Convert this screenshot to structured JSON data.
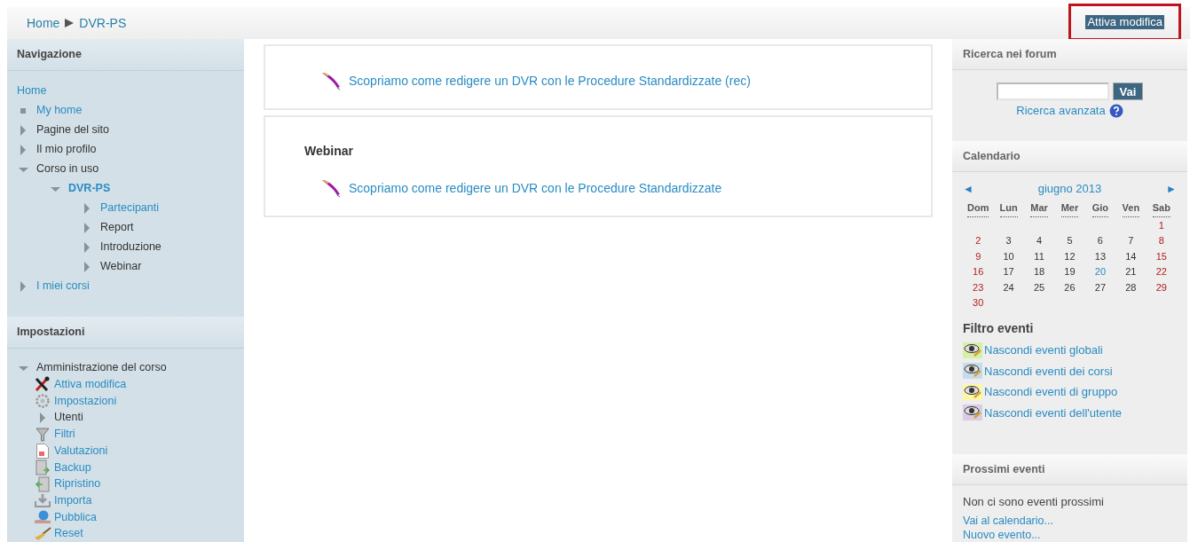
{
  "breadcrumb": [
    "Home",
    "DVR-PS"
  ],
  "edit_button": "Attiva modifica",
  "navigation": {
    "title": "Navigazione",
    "root": "Home",
    "items": [
      {
        "label": "My home",
        "kind": "leaf",
        "link": true
      },
      {
        "label": "Pagine del sito",
        "kind": "node",
        "link": false,
        "expanded": false
      },
      {
        "label": "Il mio profilo",
        "kind": "node",
        "link": false,
        "expanded": false
      },
      {
        "label": "Corso in uso",
        "kind": "node",
        "link": false,
        "expanded": true,
        "children": [
          {
            "label": "DVR-PS",
            "kind": "node",
            "link": true,
            "bold": true,
            "expanded": true,
            "children": [
              {
                "label": "Partecipanti",
                "kind": "node",
                "link": true,
                "expanded": false
              },
              {
                "label": "Report",
                "kind": "node",
                "link": false,
                "expanded": false
              },
              {
                "label": "Introduzione",
                "kind": "node",
                "link": false,
                "expanded": false
              },
              {
                "label": "Webinar",
                "kind": "node",
                "link": false,
                "expanded": false
              }
            ]
          }
        ]
      },
      {
        "label": "I miei corsi",
        "kind": "node",
        "link": true,
        "expanded": false
      }
    ]
  },
  "settings": {
    "title": "Impostazioni",
    "group": "Amministrazione del corso",
    "group_expanded": true,
    "items": [
      {
        "label": "Attiva modifica",
        "kind": "edit",
        "link": true
      },
      {
        "label": "Impostazioni",
        "kind": "gear",
        "link": true
      },
      {
        "label": "Utenti",
        "kind": "node",
        "link": false
      },
      {
        "label": "Filtri",
        "kind": "filter",
        "link": true
      },
      {
        "label": "Valutazioni",
        "kind": "grades",
        "link": true
      },
      {
        "label": "Backup",
        "kind": "backup",
        "link": true
      },
      {
        "label": "Ripristino",
        "kind": "restore",
        "link": true
      },
      {
        "label": "Importa",
        "kind": "import",
        "link": true
      },
      {
        "label": "Pubblica",
        "kind": "publish",
        "link": true
      },
      {
        "label": "Reset",
        "kind": "broom",
        "link": true
      }
    ]
  },
  "sections": [
    {
      "activity": "Scopriamo come redigere un DVR con le Procedure Standardizzate (rec)"
    },
    {
      "title": "Webinar",
      "activity": "Scopriamo come redigere un DVR con le Procedure Standardizzate"
    }
  ],
  "forum_search": {
    "title": "Ricerca nei forum",
    "button": "Vai",
    "advanced": "Ricerca avanzata"
  },
  "calendar": {
    "title": "Calendario",
    "prev": "◄",
    "month": "giugno 2013",
    "next": "►",
    "weekdays": [
      "Dom",
      "Lun",
      "Mar",
      "Mer",
      "Gio",
      "Ven",
      "Sab"
    ],
    "weeks": [
      {
        "kind": "first",
        "days": [
          {
            "day": "1",
            "kind": "weekend"
          }
        ]
      },
      {
        "kind": "full",
        "days": [
          {
            "day": "2",
            "kind": "weekend"
          },
          {
            "day": "3",
            "kind": "weekday"
          },
          {
            "day": "4",
            "kind": "weekday"
          },
          {
            "day": "5",
            "kind": "weekday"
          },
          {
            "day": "6",
            "kind": "weekday"
          },
          {
            "day": "7",
            "kind": "weekday"
          },
          {
            "day": "8",
            "kind": "weekend"
          }
        ]
      },
      {
        "kind": "full",
        "days": [
          {
            "day": "9",
            "kind": "weekend"
          },
          {
            "day": "10",
            "kind": "weekday"
          },
          {
            "day": "11",
            "kind": "weekday"
          },
          {
            "day": "12",
            "kind": "weekday"
          },
          {
            "day": "13",
            "kind": "weekday"
          },
          {
            "day": "14",
            "kind": "weekday"
          },
          {
            "day": "15",
            "kind": "weekend"
          }
        ]
      },
      {
        "kind": "full",
        "days": [
          {
            "day": "16",
            "kind": "weekend"
          },
          {
            "day": "17",
            "kind": "weekday"
          },
          {
            "day": "18",
            "kind": "weekday"
          },
          {
            "day": "19",
            "kind": "weekday"
          },
          {
            "day": "20",
            "kind": "today"
          },
          {
            "day": "21",
            "kind": "weekday"
          },
          {
            "day": "22",
            "kind": "weekend"
          }
        ]
      },
      {
        "kind": "full",
        "days": [
          {
            "day": "23",
            "kind": "weekend"
          },
          {
            "day": "24",
            "kind": "weekday"
          },
          {
            "day": "25",
            "kind": "weekday"
          },
          {
            "day": "26",
            "kind": "weekday"
          },
          {
            "day": "27",
            "kind": "weekday"
          },
          {
            "day": "28",
            "kind": "weekday"
          },
          {
            "day": "29",
            "kind": "weekend"
          }
        ]
      },
      {
        "kind": "last",
        "days": [
          {
            "day": "30",
            "kind": "weekend"
          }
        ]
      }
    ],
    "filter_title": "Filtro eventi",
    "filters": [
      {
        "label": "Nascondi eventi globali",
        "color": "#d6f0a8"
      },
      {
        "label": "Nascondi eventi dei corsi",
        "color": "#c4dcec"
      },
      {
        "label": "Nascondi eventi di gruppo",
        "color": "#fbf7a6"
      },
      {
        "label": "Nascondi eventi dell'utente",
        "color": "#dccbe6"
      }
    ]
  },
  "upcoming": {
    "title": "Prossimi eventi",
    "empty": "Non ci sono eventi prossimi",
    "links": [
      "Vai al calendario...",
      "Nuovo evento..."
    ]
  }
}
